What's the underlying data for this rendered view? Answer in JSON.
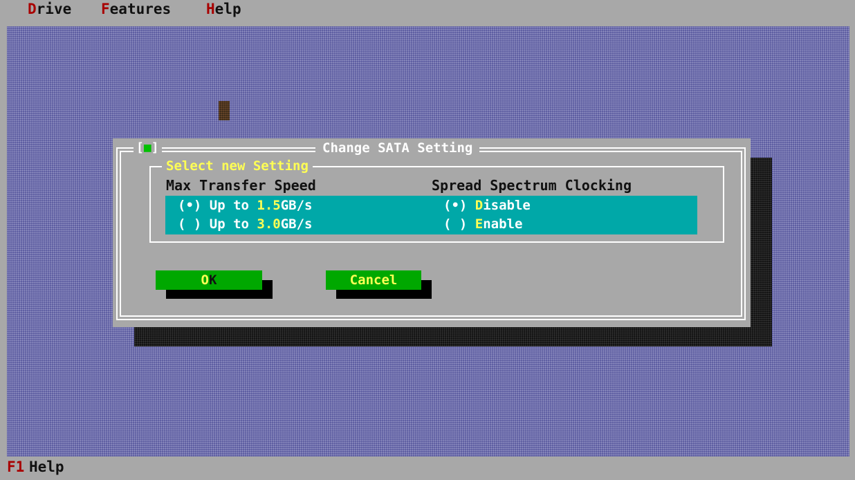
{
  "menu": {
    "items": [
      {
        "hot": "D",
        "rest": "rive"
      },
      {
        "hot": "F",
        "rest": "eatures"
      },
      {
        "hot": "H",
        "rest": "elp"
      }
    ]
  },
  "dialog": {
    "close_box": {
      "left": "[",
      "mark": "■",
      "right": "]"
    },
    "title": "Change SATA Setting",
    "group_title": "Select new Setting",
    "speed": {
      "heading": "Max Transfer Speed",
      "options": [
        {
          "radio": "(•)",
          "prefix": " Up to ",
          "hot": "1.5",
          "suffix": "GB/s"
        },
        {
          "radio": "( )",
          "prefix": " Up to ",
          "hot": "3.0",
          "suffix": "GB/s"
        }
      ]
    },
    "ssc": {
      "heading": "Spread Spectrum Clocking",
      "options": [
        {
          "radio": "(•)",
          "hot": "D",
          "rest": "isable"
        },
        {
          "radio": "( )",
          "hot": "E",
          "rest": "nable"
        }
      ]
    },
    "buttons": {
      "ok": {
        "hot": "O",
        "rest": "K"
      },
      "cancel": {
        "hot": "C",
        "rest": "ancel"
      }
    }
  },
  "status": {
    "key": "F1",
    "label": "Help"
  },
  "colors": {
    "desktop": "#5c5ca0",
    "dialog": "#a8a8a8",
    "options_band": "#00a8a8",
    "button": "#00a800",
    "highlight": "#ffff54",
    "hotkey": "#a80000"
  }
}
